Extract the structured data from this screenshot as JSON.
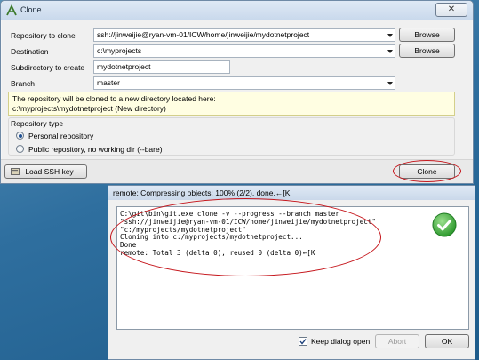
{
  "clone_dialog": {
    "title": "Clone",
    "close_glyph": "✕",
    "repo_label": "Repository to clone",
    "repo_value": "ssh://jinweijie@ryan-vm-01/ICW/home/jinweijie/mydotnetproject",
    "dest_label": "Destination",
    "dest_value": "c:\\myprojects",
    "subdir_label": "Subdirectory to create",
    "subdir_value": "mydotnetproject",
    "branch_label": "Branch",
    "branch_value": "master",
    "browse_label": "Browse",
    "info_line1": "The repository will be cloned to a new directory located here:",
    "info_line2": "c:\\myprojects\\mydotnetproject (New directory)",
    "repo_type_title": "Repository type",
    "personal_label": "Personal repository",
    "public_label": "Public repository, no working dir  (--bare)",
    "load_ssh_label": "Load SSH key",
    "clone_button_label": "Clone"
  },
  "progress_dialog": {
    "title": "remote: Compressing objects: 100% (2/2), done.←[K",
    "console_lines": [
      "C:\\git\\bin\\git.exe clone -v --progress --branch master",
      "\"ssh://jinweijie@ryan-vm-01/ICW/home/jinweijie/mydotnetproject\"",
      "\"c:/myprojects/mydotnetproject\"",
      "Cloning into c:/myprojects/mydotnetproject...",
      "Done",
      "remote: Total 3 (delta 0), reused 0 (delta 0)←[K"
    ],
    "keep_open_label": "Keep dialog open",
    "keep_open_checked": true,
    "abort_label": "Abort",
    "ok_label": "OK"
  },
  "colors": {
    "highlight_ring": "#c5151b",
    "success_green": "#2e9a2e"
  }
}
